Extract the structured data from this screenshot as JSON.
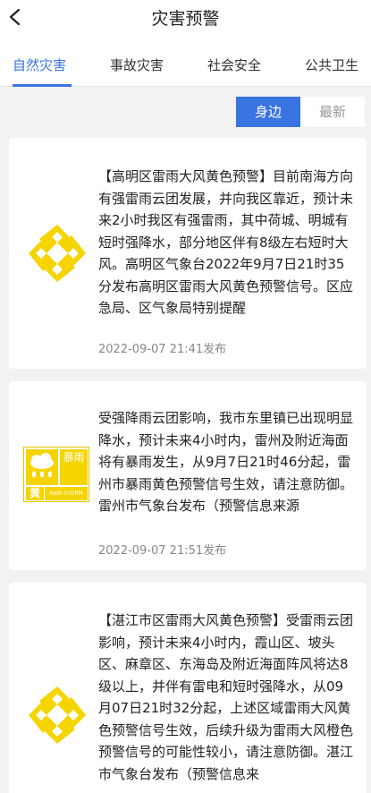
{
  "header": {
    "title": "灾害预警"
  },
  "tabs": [
    {
      "label": "自然灾害",
      "active": true
    },
    {
      "label": "事故灾害",
      "active": false
    },
    {
      "label": "社会安全",
      "active": false
    },
    {
      "label": "公共卫生",
      "active": false
    }
  ],
  "filter": {
    "nearby": "身边",
    "latest": "最新"
  },
  "colors": {
    "accent": "#3a74e0",
    "warning_yellow": "#f5d400"
  },
  "warnings": [
    {
      "icon": "yellow-thunderstorm-wind-warning-icon",
      "text": "【高明区雷雨大风黄色预警】目前南海方向有强雷雨云团发展，并向我区靠近，预计未来2小时我区有强雷雨，其中荷城、明城有短时强降水，部分地区伴有8级左右短时大风。高明区气象台2022年9月7日21时35分发布高明区雷雨大风黄色预警信号。区应急局、区气象局特别提醒",
      "time": "2022-09-07 21:41发布"
    },
    {
      "icon": "yellow-rainstorm-warning-icon",
      "icon_label_cn": "暴雨",
      "icon_label_color": "黄",
      "icon_label_en": "RAIN STORM",
      "text": "受强降雨云团影响，我市东里镇已出现明显降水，预计未来4小时内，雷州及附近海面将有暴雨发生，从9月7日21时46分起，雷州市暴雨黄色预警信号生效，请注意防御。雷州市气象台发布（预警信息来源",
      "time": "2022-09-07 21:51发布"
    },
    {
      "icon": "yellow-thunderstorm-wind-warning-icon",
      "text": "【湛江市区雷雨大风黄色预警】受雷雨云团影响，预计未来4小时内，霞山区、坡头区、麻章区、东海岛及附近海面阵风将达8级以上，并伴有雷电和短时强降水，从09月07日21时32分起，上述区域雷雨大风黄色预警信号生效，后续升级为雷雨大风橙色预警信号的可能性较小，请注意防御。湛江市气象台发布（预警信息来"
    }
  ]
}
